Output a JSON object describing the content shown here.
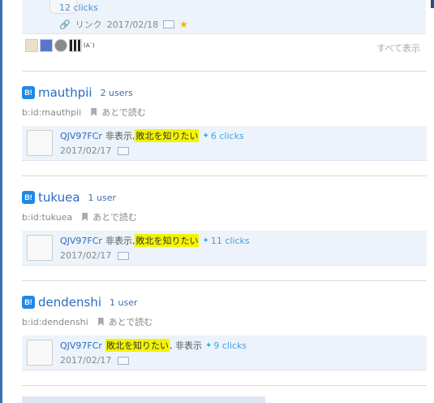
{
  "top": {
    "clicks": "12 clicks",
    "link_label": "リンク",
    "date": "2017/02/18",
    "see_all": "すべて表示",
    "avatars": [
      {
        "color": "#e8e0c8"
      },
      {
        "color": "#5577cc"
      },
      {
        "color": "#8a8a8a"
      },
      {
        "color": "#222222"
      },
      {
        "color": "#ffffff",
        "text": "(A`)"
      }
    ]
  },
  "entries": [
    {
      "username": "mauthpii",
      "user_count": "2 users",
      "id_text": "b:id:mauthpii",
      "read_later": "あとで読む",
      "comment": {
        "user": "QJV97FCr",
        "prefix": "非表示,",
        "highlight": "敗北を知りたい",
        "suffix": "",
        "clicks": "6 clicks",
        "date": "2017/02/17"
      }
    },
    {
      "username": "tukuea",
      "user_count": "1 user",
      "id_text": "b:id:tukuea",
      "read_later": "あとで読む",
      "comment": {
        "user": "QJV97FCr",
        "prefix": "非表示,",
        "highlight": "敗北を知りたい",
        "suffix": "",
        "clicks": "11 clicks",
        "date": "2017/02/17"
      }
    },
    {
      "username": "dendenshi",
      "user_count": "1 user",
      "id_text": "b:id:dendenshi",
      "read_later": "あとで読む",
      "comment": {
        "user": "QJV97FCr",
        "prefix": "",
        "highlight": "敗北を知りたい",
        "suffix": ", 非表示",
        "clicks": "9 clicks",
        "date": "2017/02/17"
      }
    }
  ],
  "badge_label": "B!",
  "colors": {
    "link": "#2b6bbf",
    "highlight": "#f4f400",
    "twitter": "#42a3e6",
    "badge": "#1e88e5"
  }
}
